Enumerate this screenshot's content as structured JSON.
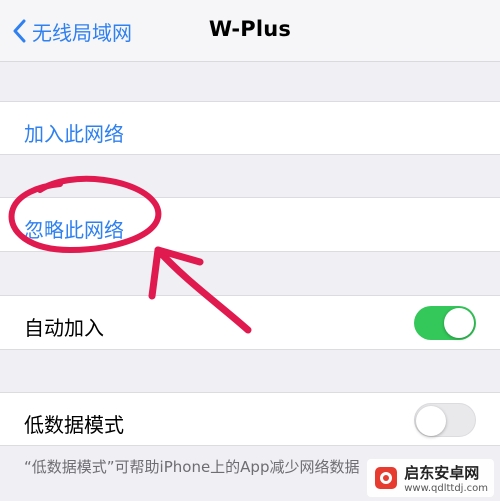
{
  "nav": {
    "back_label": "无线局域网",
    "title": "W-Plus"
  },
  "rows": {
    "join": "加入此网络",
    "forget": "忽略此网络",
    "auto_join": {
      "label": "自动加入",
      "on": true
    },
    "low_data": {
      "label": "低数据模式",
      "on": false
    }
  },
  "footnote": "“低数据模式”可帮助iPhone上的App减少网络数据",
  "watermark": {
    "title": "启东安卓网",
    "url": "www.qdlttdj.com"
  },
  "colors": {
    "accent": "#2f80f0",
    "toggle_on": "#34c759",
    "annotation": "#e0194f",
    "toggle_off": "#e9e9eb"
  }
}
